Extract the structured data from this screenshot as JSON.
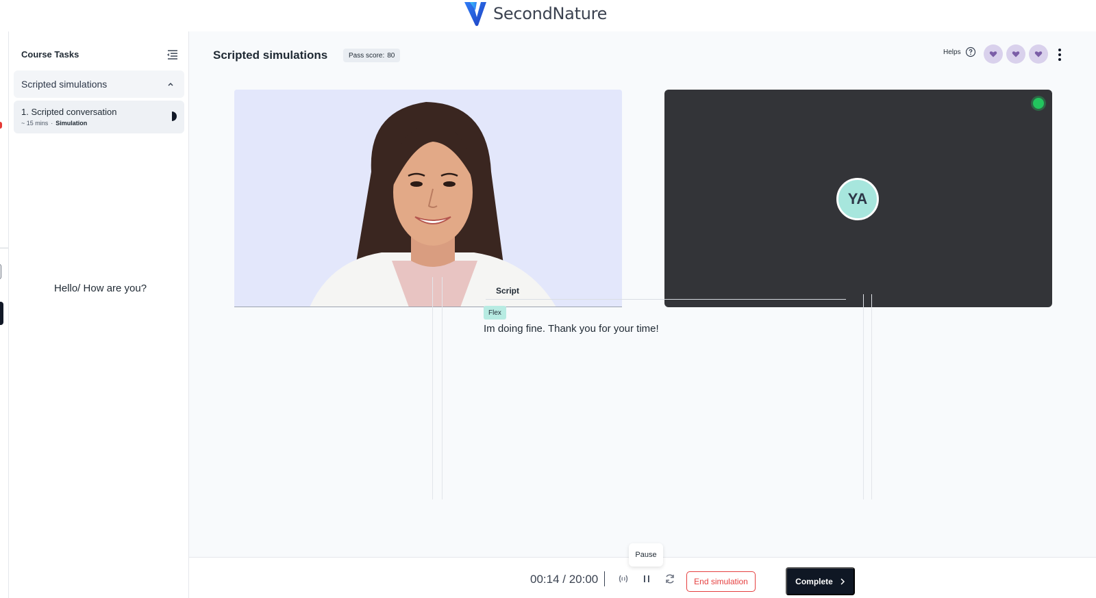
{
  "brand": {
    "name": "SecondNature",
    "logo_icon": "v-logo-icon"
  },
  "sidebar": {
    "title": "Course Tasks",
    "section": {
      "label": "Scripted simulations",
      "expanded": true
    },
    "tasks": [
      {
        "title": "1. Scripted conversation",
        "duration": "~ 15 mins",
        "separator": "·",
        "kind": "Simulation",
        "progress": 0.5
      }
    ]
  },
  "header": {
    "title": "Scripted simulations",
    "pass_score_label": "Pass score:",
    "pass_score_value": "80",
    "helps_label": "Helps",
    "hearts_count": 3,
    "heart_color": "#7b5ea7"
  },
  "avatar": {
    "caption": "Hello/ How are you?",
    "background": "#e3e7fb"
  },
  "user_video": {
    "initials": "YA",
    "live": true
  },
  "script": {
    "label": "Script",
    "tag": "Flex",
    "text": "Im doing fine. Thank you for your time!"
  },
  "controls": {
    "timer": "00:14 / 20:00",
    "tooltip": "Pause",
    "end_label": "End simulation",
    "complete_label": "Complete"
  },
  "colors": {
    "accent_red": "#e53e3e",
    "primary_dark": "#0f1724",
    "flex_chip": "#b7ebe2",
    "live_green": "#22c55e"
  }
}
